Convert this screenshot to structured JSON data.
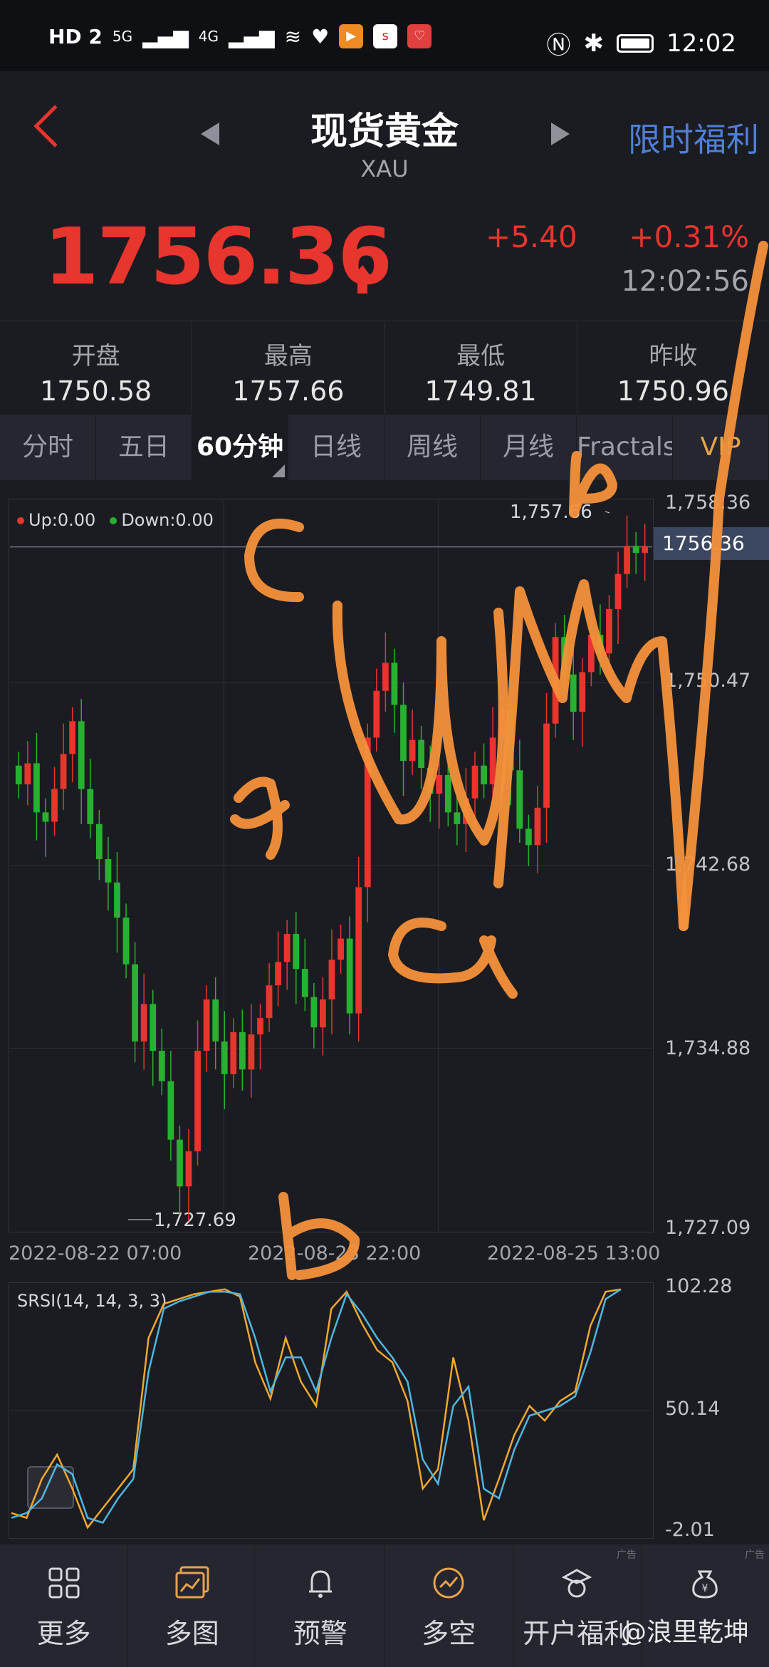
{
  "status_bar": {
    "left_labels": [
      "HD 2",
      "5G",
      "4G"
    ],
    "time": "12:02"
  },
  "header": {
    "title": "现货黄金",
    "subtitle": "XAU",
    "promo": "限时福利"
  },
  "quote": {
    "price": "1756.36",
    "change": "+5.40",
    "change_pct": "+0.31%",
    "time": "12:02:56"
  },
  "stats": [
    {
      "label": "开盘",
      "value": "1750.58"
    },
    {
      "label": "最高",
      "value": "1757.66"
    },
    {
      "label": "最低",
      "value": "1749.81"
    },
    {
      "label": "昨收",
      "value": "1750.96"
    }
  ],
  "tabs": [
    {
      "label": "分时"
    },
    {
      "label": "五日"
    },
    {
      "label": "60分钟"
    },
    {
      "label": "日线"
    },
    {
      "label": "周线"
    },
    {
      "label": "月线"
    },
    {
      "label": "Fractals"
    },
    {
      "label": "VIP"
    }
  ],
  "chart_data": [
    {
      "type": "candlestick",
      "legend": [
        {
          "name": "Up:0.00",
          "color": "#e8352e"
        },
        {
          "name": "Down:0.00",
          "color": "#28b130"
        }
      ],
      "y_ticks": [
        "1,758.36",
        "1,750.47",
        "1,742.68",
        "1,734.88",
        "1,727.09"
      ],
      "ylim": [
        1727.09,
        1758.36
      ],
      "current_price_label": "1756.36",
      "x_ticks": [
        "2022-08-22 07:00",
        "2022-08-23 22:00",
        "2022-08-25 13:00"
      ],
      "annotations": [
        "1,757.66",
        "1,727.69"
      ],
      "candles_close": [
        1746.2,
        1747.1,
        1745.0,
        1744.6,
        1746.0,
        1747.5,
        1748.9,
        1746.0,
        1744.5,
        1743.0,
        1742.0,
        1740.5,
        1738.5,
        1735.2,
        1736.8,
        1734.8,
        1733.5,
        1731.0,
        1729.0,
        1730.5,
        1734.8,
        1737.0,
        1735.2,
        1733.8,
        1735.6,
        1734.0,
        1735.5,
        1736.2,
        1737.6,
        1738.6,
        1739.8,
        1738.3,
        1737.1,
        1735.8,
        1737.0,
        1738.7,
        1739.6,
        1736.4,
        1741.8,
        1748.2,
        1750.2,
        1751.4,
        1749.6,
        1747.2,
        1748.1,
        1746.9,
        1745.8,
        1746.6,
        1745.0,
        1744.5,
        1745.6,
        1747.0,
        1746.2,
        1748.2,
        1749.4,
        1746.8,
        1744.3,
        1743.6,
        1745.2,
        1748.8,
        1752.5,
        1750.9,
        1749.3,
        1751.0,
        1752.6,
        1751.8,
        1753.7,
        1755.2,
        1756.4,
        1756.1,
        1756.4
      ],
      "candles_open": [
        1747.0,
        1746.2,
        1747.1,
        1745.0,
        1744.6,
        1746.0,
        1747.5,
        1748.9,
        1746.0,
        1744.5,
        1743.0,
        1742.0,
        1740.5,
        1738.5,
        1735.2,
        1736.8,
        1734.8,
        1733.5,
        1731.0,
        1729.0,
        1730.5,
        1734.8,
        1737.0,
        1735.2,
        1733.8,
        1735.6,
        1734.0,
        1735.5,
        1736.2,
        1737.6,
        1738.6,
        1739.8,
        1738.3,
        1737.1,
        1735.8,
        1737.0,
        1738.7,
        1739.6,
        1736.4,
        1741.8,
        1748.2,
        1750.2,
        1751.4,
        1749.6,
        1747.2,
        1748.1,
        1746.9,
        1745.8,
        1746.6,
        1745.0,
        1744.5,
        1745.6,
        1747.0,
        1746.2,
        1748.2,
        1749.4,
        1746.8,
        1744.3,
        1743.6,
        1745.2,
        1748.8,
        1752.5,
        1750.9,
        1749.3,
        1751.0,
        1752.6,
        1751.8,
        1753.7,
        1755.2,
        1756.4,
        1756.1
      ]
    },
    {
      "type": "line",
      "title": "SRSI(14, 14, 3, 3)",
      "y_ticks": [
        "102.28",
        "50.14",
        "-2.01"
      ],
      "ylim": [
        -2.01,
        102.28
      ],
      "series": [
        {
          "color": "#f0a830",
          "values": [
            8,
            6,
            22,
            32,
            18,
            2,
            10,
            18,
            26,
            80,
            94,
            96,
            98,
            99,
            100,
            97,
            70,
            55,
            80,
            62,
            52,
            92,
            99,
            86,
            75,
            70,
            54,
            18,
            26,
            72,
            46,
            5,
            22,
            40,
            52,
            46,
            54,
            58,
            85,
            99,
            100
          ]
        },
        {
          "color": "#4fb6e0",
          "values": [
            6,
            8,
            14,
            28,
            24,
            6,
            4,
            14,
            22,
            66,
            92,
            95,
            97,
            99,
            99,
            98,
            80,
            58,
            72,
            72,
            58,
            80,
            98,
            90,
            80,
            72,
            62,
            30,
            20,
            52,
            60,
            18,
            14,
            34,
            48,
            50,
            52,
            56,
            74,
            96,
            100
          ]
        }
      ]
    }
  ],
  "handwriting": {
    "labels": [
      "c",
      "a",
      "b",
      "a",
      "b"
    ]
  },
  "bottom_nav": [
    {
      "label": "更多",
      "icon": "grid-icon"
    },
    {
      "label": "多图",
      "icon": "multi-chart-icon"
    },
    {
      "label": "预警",
      "icon": "bell-icon"
    },
    {
      "label": "多空",
      "icon": "long-short-icon"
    },
    {
      "label": "开户福利",
      "icon": "gift-icon"
    },
    {
      "label": "",
      "icon": "yen-bag-icon"
    }
  ],
  "watermark": "@浪里乾坤",
  "ad_tags": [
    "广告",
    "广告"
  ]
}
